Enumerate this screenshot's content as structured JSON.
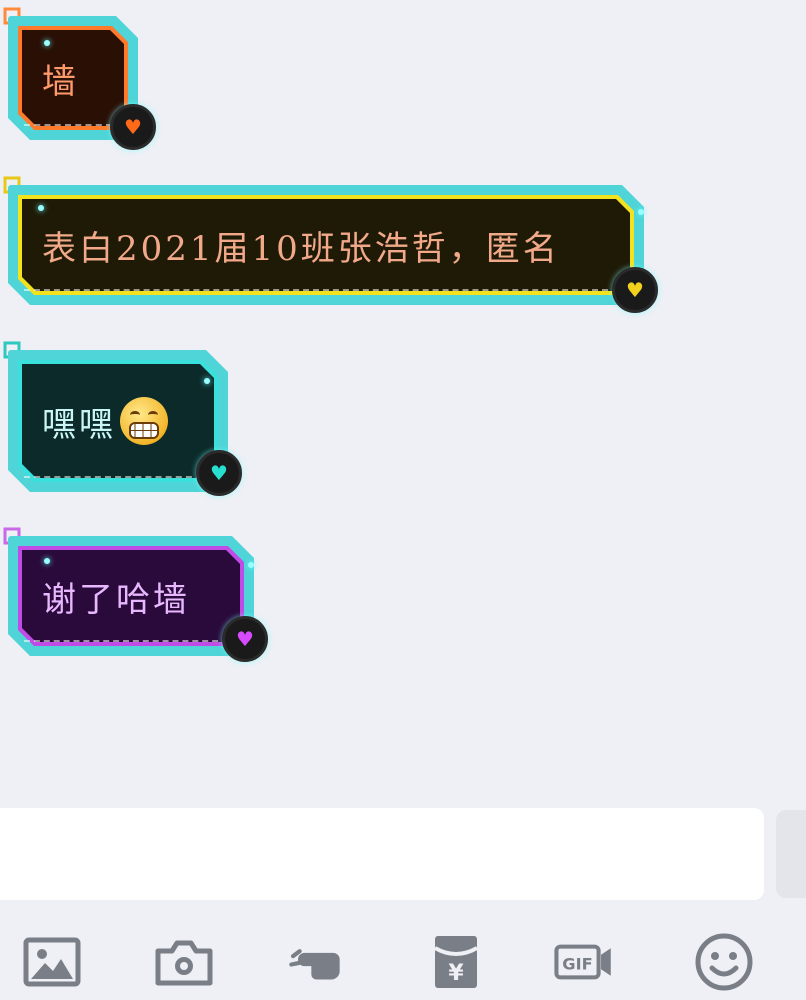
{
  "messages": [
    {
      "text": "墙",
      "accent": "#ff7a2a",
      "heart": "#ff6a1a"
    },
    {
      "text": "表白2021届10班张浩哲，匿名",
      "accent": "#f3e21e",
      "heart": "#f3d21e"
    },
    {
      "text": "嘿嘿",
      "emoji": "grimacing-face",
      "accent": "#3ae0dc",
      "heart": "#28e0cf"
    },
    {
      "text": "谢了哈墙",
      "accent": "#c04be6",
      "heart": "#d64bff"
    }
  ],
  "input": {
    "value": "",
    "placeholder": ""
  },
  "toolbar": [
    {
      "icon": "image-icon"
    },
    {
      "icon": "camera-icon"
    },
    {
      "icon": "poke-hand-icon"
    },
    {
      "icon": "red-packet-icon",
      "label": "¥"
    },
    {
      "icon": "gif-icon",
      "label": "GIF"
    },
    {
      "icon": "emoji-icon"
    }
  ],
  "colors": {
    "background": "#eef0f5",
    "frame": "#4fd4d8",
    "icon": "#7a7e86"
  }
}
